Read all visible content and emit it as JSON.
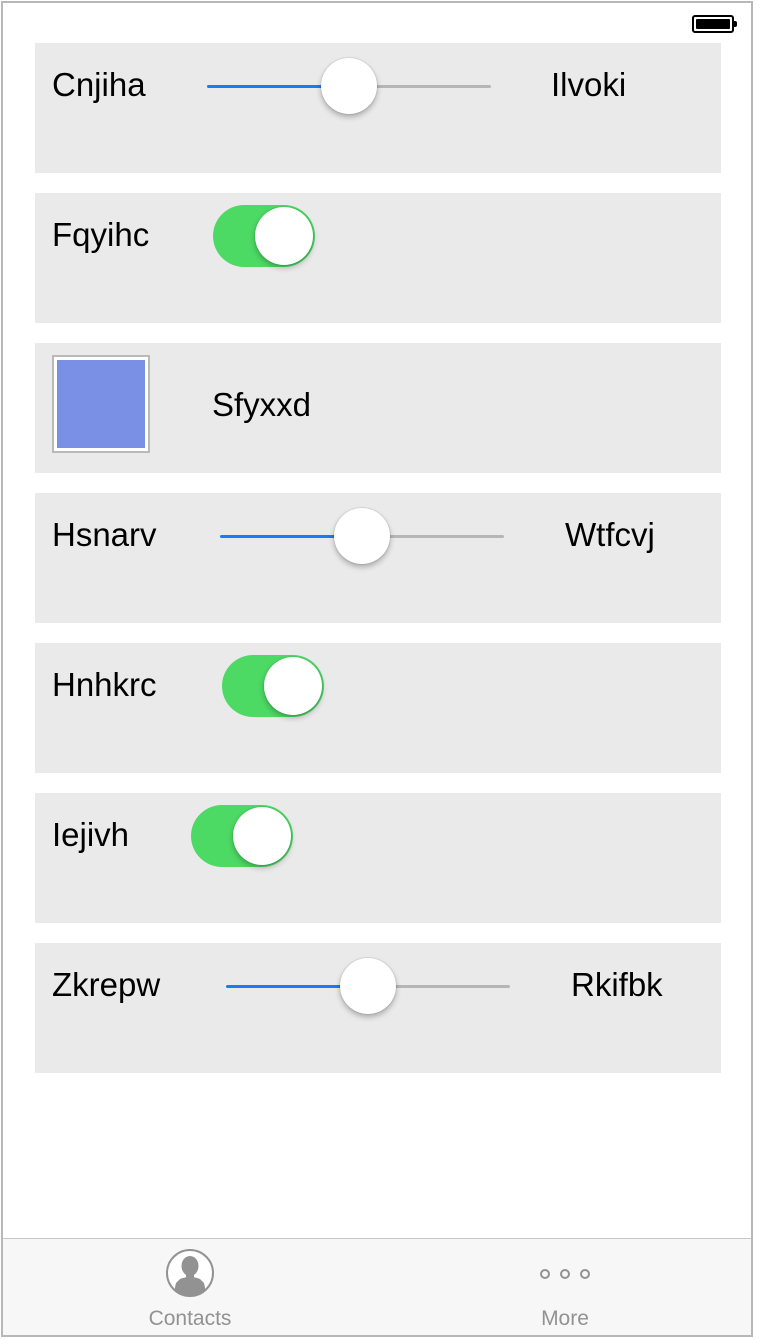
{
  "rows": [
    {
      "type": "slider",
      "label": "Cnjiha",
      "value_label": "Ilvoki",
      "value": 0.5
    },
    {
      "type": "toggle",
      "label": "Fqyihc",
      "on": true
    },
    {
      "type": "color",
      "label": "Sfyxxd",
      "color": "#7a90e4"
    },
    {
      "type": "slider",
      "label": "Hsnarv",
      "value_label": "Wtfcvj",
      "value": 0.5
    },
    {
      "type": "toggle",
      "label": "Hnhkrc",
      "on": true
    },
    {
      "type": "toggle",
      "label": "Iejivh",
      "on": true
    },
    {
      "type": "slider",
      "label": "Zkrepw",
      "value_label": "Rkifbk",
      "value": 0.5
    }
  ],
  "tabbar": {
    "contacts_label": "Contacts",
    "more_label": "More"
  },
  "colors": {
    "accent": "#1a7cf4",
    "toggle_on": "#4cd964",
    "row_bg": "#eaeaea",
    "tab_text": "#929292"
  }
}
